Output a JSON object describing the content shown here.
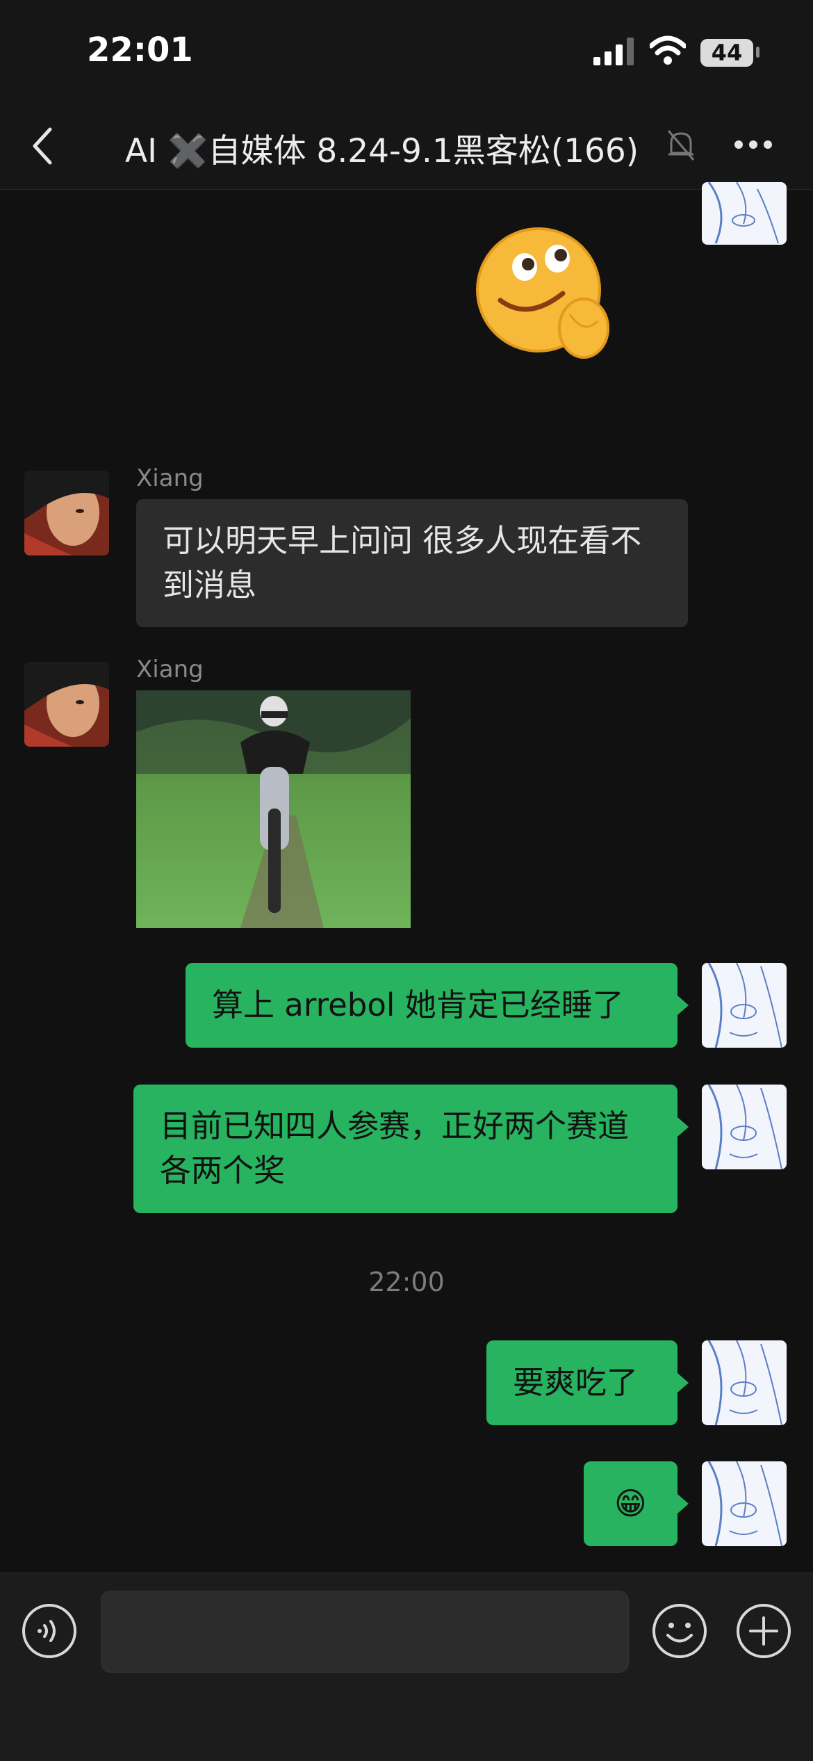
{
  "status_bar": {
    "time": "22:01",
    "battery": "44"
  },
  "nav": {
    "title": "AI ✖️自媒体 8.24-9.1黑客松(166)"
  },
  "messages": {
    "m2": {
      "sender": "Xiang",
      "text": "可以明天早上问问 很多人现在看不到消息"
    },
    "m3": {
      "sender": "Xiang"
    },
    "m4": {
      "text": "算上 arrebol 她肯定已经睡了"
    },
    "m5": {
      "text": "目前已知四人参赛，正好两个赛道各两个奖"
    },
    "timestamp": "22:00",
    "m6": {
      "text": "要爽吃了"
    },
    "m7": {
      "text": "😁"
    }
  },
  "colors": {
    "outgoing_bubble": "#27b35f",
    "incoming_bubble": "#2c2c2c",
    "background": "#111111"
  },
  "icons": [
    "back-icon",
    "mute-icon",
    "more-icon",
    "voice-icon",
    "emoji-icon",
    "plus-icon"
  ]
}
